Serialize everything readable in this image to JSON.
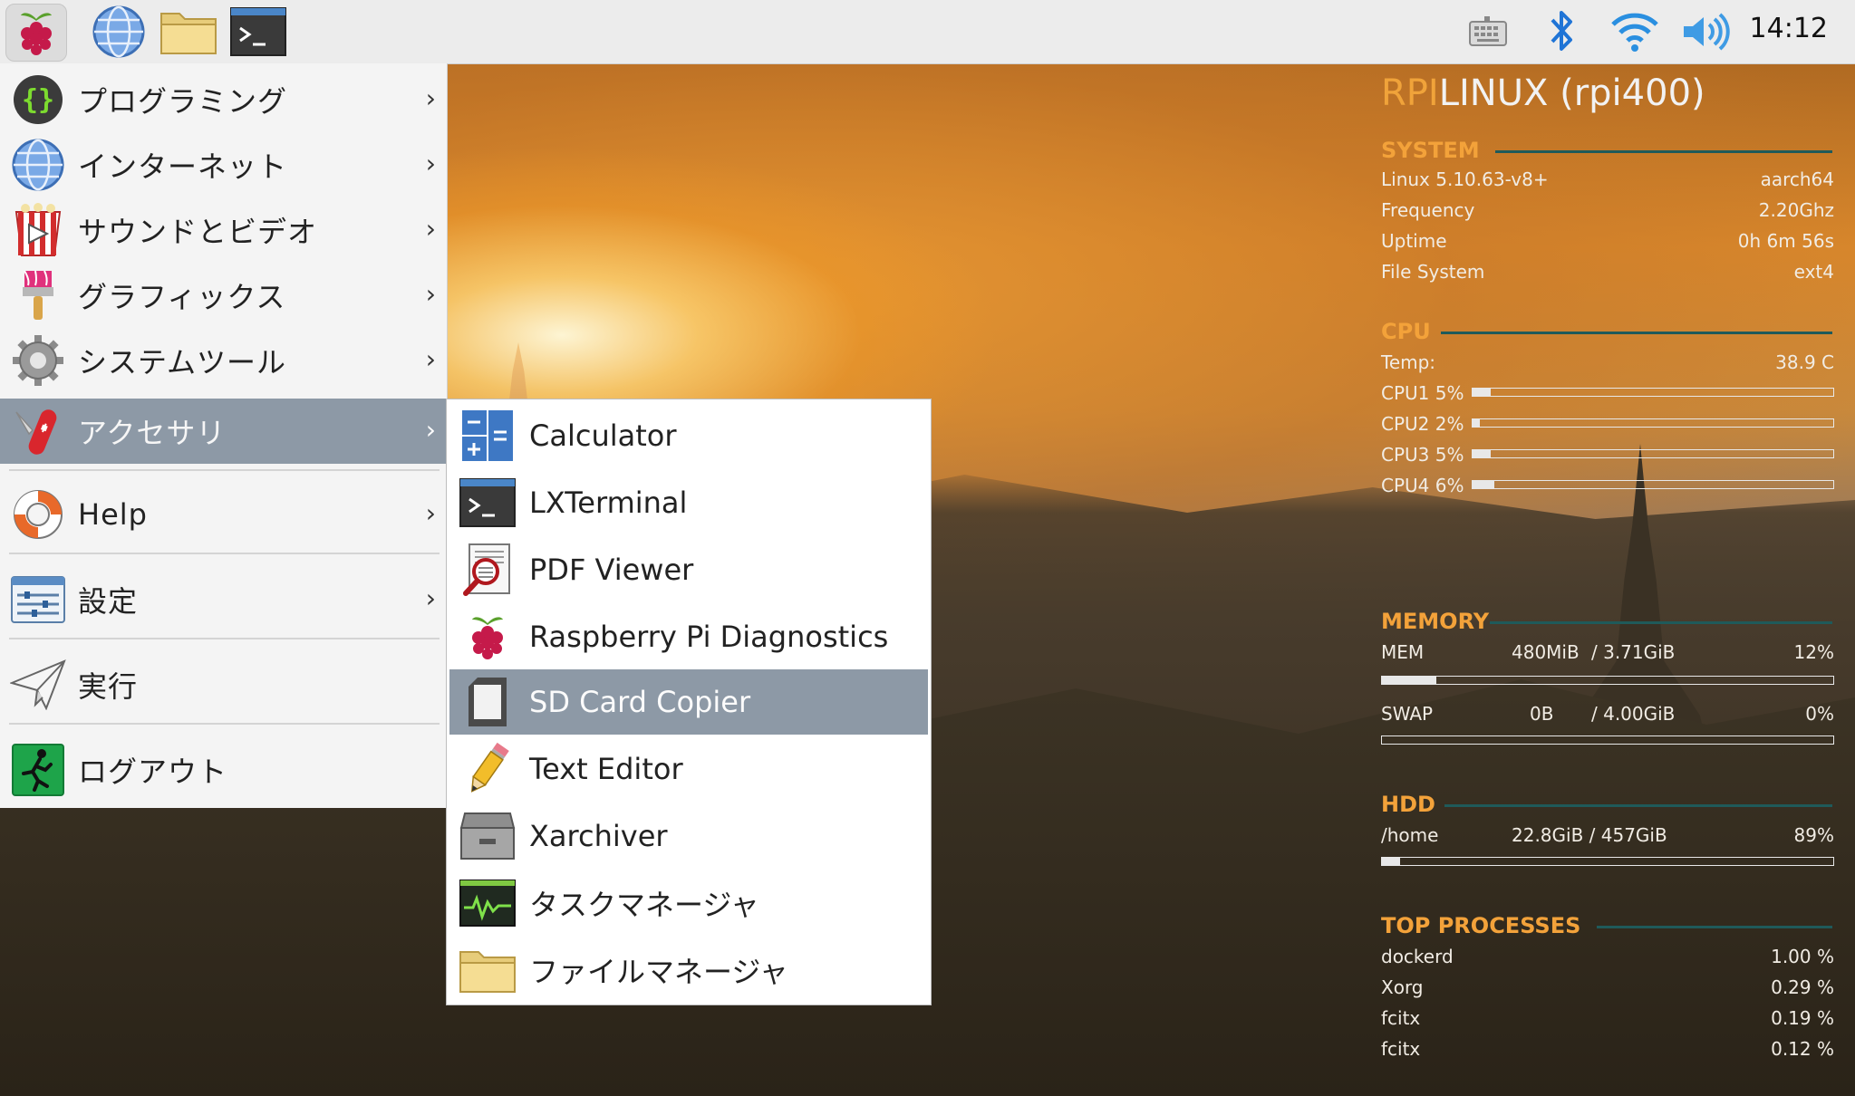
{
  "taskbar": {
    "clock": "14:12",
    "icons": [
      "raspberry-menu-icon",
      "web-browser-icon",
      "file-manager-icon",
      "terminal-icon",
      "keyboard-icon",
      "bluetooth-icon",
      "wifi-icon",
      "volume-icon"
    ]
  },
  "main_menu": {
    "items": [
      {
        "label": "プログラミング",
        "icon": "programming-icon",
        "has_submenu": true
      },
      {
        "label": "インターネット",
        "icon": "internet-globe-icon",
        "has_submenu": true
      },
      {
        "label": "サウンドとビデオ",
        "icon": "sound-video-icon",
        "has_submenu": true
      },
      {
        "label": "グラフィックス",
        "icon": "graphics-brush-icon",
        "has_submenu": true
      },
      {
        "label": "システムツール",
        "icon": "system-tools-gear-icon",
        "has_submenu": true
      },
      {
        "label": "アクセサリ",
        "icon": "accessories-knife-icon",
        "has_submenu": true,
        "active": true
      },
      {
        "label": "Help",
        "icon": "help-lifebuoy-icon",
        "has_submenu": true
      },
      {
        "label": "設定",
        "icon": "settings-icon",
        "has_submenu": true
      },
      {
        "label": "実行",
        "icon": "run-paper-plane-icon",
        "has_submenu": false
      },
      {
        "label": "ログアウト",
        "icon": "logout-exit-icon",
        "has_submenu": false
      }
    ]
  },
  "accessories_menu": {
    "items": [
      {
        "label": "Calculator",
        "icon": "calculator-icon"
      },
      {
        "label": "LXTerminal",
        "icon": "terminal-icon"
      },
      {
        "label": "PDF Viewer",
        "icon": "pdf-viewer-icon"
      },
      {
        "label": "Raspberry Pi Diagnostics",
        "icon": "raspberry-icon"
      },
      {
        "label": "SD Card Copier",
        "icon": "sd-card-icon",
        "active": true
      },
      {
        "label": "Text Editor",
        "icon": "pencil-icon"
      },
      {
        "label": "Xarchiver",
        "icon": "archive-drawer-icon"
      },
      {
        "label": "タスクマネージャ",
        "icon": "task-monitor-icon"
      },
      {
        "label": "ファイルマネージャ",
        "icon": "folder-icon"
      }
    ]
  },
  "conky": {
    "host_prefix": "RPI",
    "host_rest": "LINUX (rpi400)",
    "system": {
      "heading": "SYSTEM",
      "rows": [
        {
          "label": "Linux 5.10.63-v8+",
          "value": "aarch64"
        },
        {
          "label": "Frequency",
          "value": "2.20Ghz"
        },
        {
          "label": "Uptime",
          "value": "0h 6m 56s"
        },
        {
          "label": "File System",
          "value": "ext4"
        }
      ]
    },
    "cpu": {
      "heading": "CPU",
      "temp_label": "Temp:",
      "temp_value": "38.9 C",
      "cores": [
        {
          "label": "CPU1",
          "pct_text": "5%",
          "pct": 0.05
        },
        {
          "label": "CPU2",
          "pct_text": "2%",
          "pct": 0.02
        },
        {
          "label": "CPU3",
          "pct_text": "5%",
          "pct": 0.05
        },
        {
          "label": "CPU4",
          "pct_text": "6%",
          "pct": 0.06
        }
      ]
    },
    "memory": {
      "heading": "MEMORY",
      "mem_label": "MEM",
      "mem_used": "480MiB",
      "mem_total": "/ 3.71GiB",
      "mem_pct": "12%",
      "mem_fill": 0.12,
      "swap_label": "SWAP",
      "swap_used": "0B",
      "swap_total": "/ 4.00GiB",
      "swap_pct": "0%",
      "swap_fill": 0.0
    },
    "hdd": {
      "heading": "HDD",
      "mount": "/home",
      "usage": "22.8GiB / 457GiB",
      "pct": "89%",
      "fill": 0.04
    },
    "processes": {
      "heading": "TOP PROCESSES",
      "rows": [
        {
          "name": "dockerd",
          "cpu": "1.00 %"
        },
        {
          "name": "Xorg",
          "cpu": "0.29 %"
        },
        {
          "name": "fcitx",
          "cpu": "0.19 %"
        },
        {
          "name": "fcitx",
          "cpu": "0.12 %"
        }
      ]
    }
  }
}
